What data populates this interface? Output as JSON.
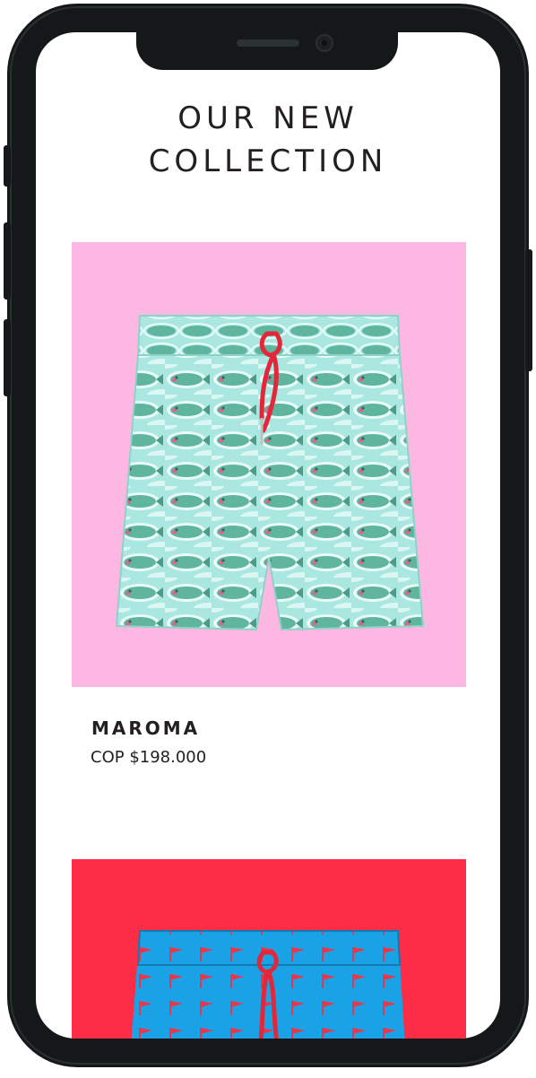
{
  "collection": {
    "title_line1": "OUR NEW",
    "title_line2": "COLLECTION"
  },
  "products": [
    {
      "name": "MAROMA",
      "price": "COP $198.000",
      "bg_color": "#fcb8e2",
      "print": "fish"
    },
    {
      "bg_color": "#fd2c47",
      "print": "flags"
    }
  ],
  "colors": {
    "frame": "#151819",
    "text": "#231f20",
    "short1_base": "#a9e7e0",
    "short1_fish": "#4fa68f",
    "short2_base": "#19a3e6",
    "drawstring": "#e3263a"
  }
}
